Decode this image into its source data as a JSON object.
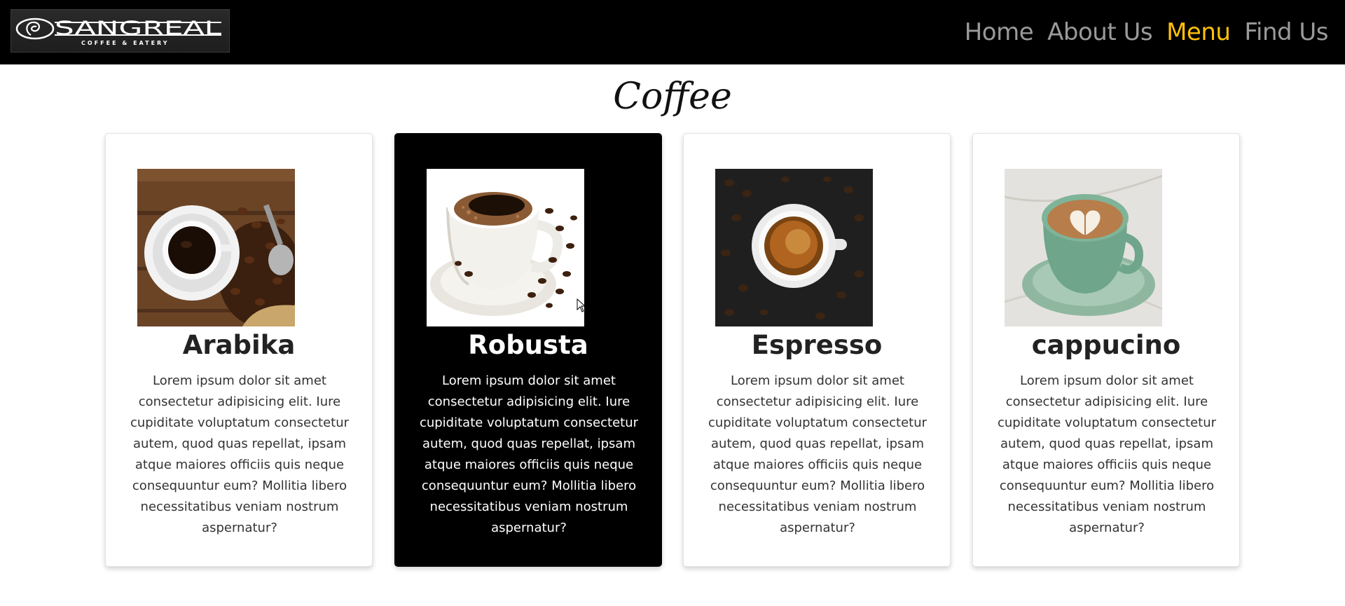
{
  "brand": {
    "logo_text": "SANGREAL",
    "logo_tagline": "COFFEE & EATERY"
  },
  "nav": {
    "links": [
      {
        "label": "Home",
        "active": false
      },
      {
        "label": "About Us",
        "active": false
      },
      {
        "label": "Menu",
        "active": true
      },
      {
        "label": "Find Us",
        "active": false
      }
    ],
    "colors": {
      "default": "#9a9a9a",
      "active": "#ffc107",
      "background": "#000000"
    }
  },
  "section": {
    "title": "Coffee"
  },
  "cards": [
    {
      "title": "Arabika",
      "image_icon": "coffee-cup-on-wood-icon",
      "theme": "light",
      "text": "Lorem ipsum dolor sit amet consectetur adipisicing elit. Iure cupiditate voluptatum consectetur autem, quod quas repellat, ipsam atque maiores officiis quis neque consequuntur eum? Mollitia libero necessitatibus veniam nostrum aspernatur?"
    },
    {
      "title": "Robusta",
      "image_icon": "coffee-cup-on-saucer-icon",
      "theme": "dark",
      "text": "Lorem ipsum dolor sit amet consectetur adipisicing elit. Iure cupiditate voluptatum consectetur autem, quod quas repellat, ipsam atque maiores officiis quis neque consequuntur eum? Mollitia libero necessitatibus veniam nostrum aspernatur?"
    },
    {
      "title": "Espresso",
      "image_icon": "espresso-cup-icon",
      "theme": "light",
      "text": "Lorem ipsum dolor sit amet consectetur adipisicing elit. Iure cupiditate voluptatum consectetur autem, quod quas repellat, ipsam atque maiores officiis quis neque consequuntur eum? Mollitia libero necessitatibus veniam nostrum aspernatur?"
    },
    {
      "title": "cappucino",
      "image_icon": "latte-art-cup-icon",
      "theme": "light",
      "text": "Lorem ipsum dolor sit amet consectetur adipisicing elit. Iure cupiditate voluptatum consectetur autem, quod quas repellat, ipsam atque maiores officiis quis neque consequuntur eum? Mollitia libero necessitatibus veniam nostrum aspernatur?"
    }
  ]
}
